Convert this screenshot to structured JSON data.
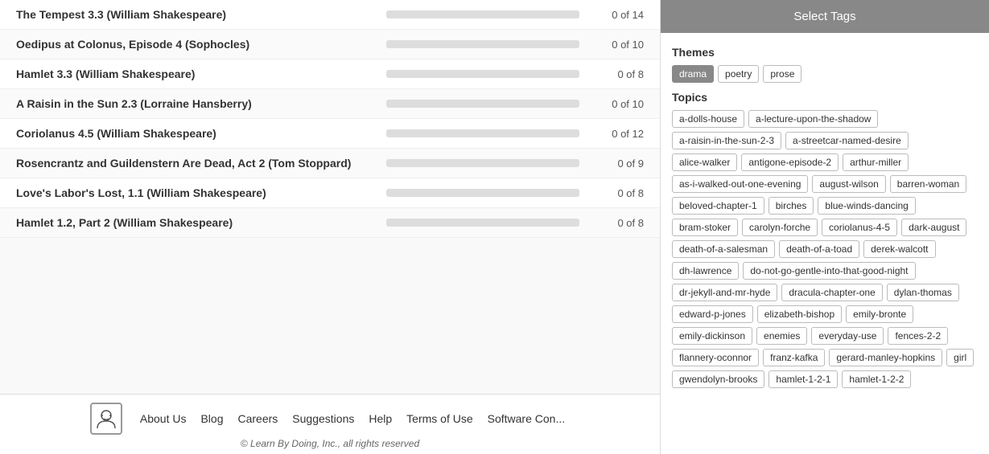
{
  "left": {
    "courses": [
      {
        "title": "The Tempest 3.3 (William Shakespeare)",
        "progress": 0,
        "total": 14
      },
      {
        "title": "Oedipus at Colonus, Episode 4 (Sophocles)",
        "progress": 0,
        "total": 10
      },
      {
        "title": "Hamlet 3.3 (William Shakespeare)",
        "progress": 0,
        "total": 8
      },
      {
        "title": "A Raisin in the Sun 2.3 (Lorraine Hansberry)",
        "progress": 0,
        "total": 10
      },
      {
        "title": "Coriolanus 4.5 (William Shakespeare)",
        "progress": 0,
        "total": 12
      },
      {
        "title": "Rosencrantz and Guildenstern Are Dead, Act 2 (Tom Stoppard)",
        "progress": 0,
        "total": 9
      },
      {
        "title": "Love's Labor's Lost, 1.1 (William Shakespeare)",
        "progress": 0,
        "total": 8
      },
      {
        "title": "Hamlet 1.2, Part 2 (William Shakespeare)",
        "progress": 0,
        "total": 8
      }
    ],
    "footer": {
      "links": [
        "About Us",
        "Blog",
        "Careers",
        "Suggestions",
        "Help",
        "Terms of Use",
        "Software Con..."
      ],
      "copyright": "© Learn By Doing, Inc., all rights reserved"
    }
  },
  "right": {
    "header": "Select Tags",
    "themes_label": "Themes",
    "themes": [
      {
        "label": "drama",
        "selected": true
      },
      {
        "label": "poetry",
        "selected": false
      },
      {
        "label": "prose",
        "selected": false
      }
    ],
    "topics_label": "Topics",
    "topics": [
      "a-dolls-house",
      "a-lecture-upon-the-shadow",
      "a-raisin-in-the-sun-2-3",
      "a-streetcar-named-desire",
      "alice-walker",
      "antigone-episode-2",
      "arthur-miller",
      "as-i-walked-out-one-evening",
      "august-wilson",
      "barren-woman",
      "beloved-chapter-1",
      "birches",
      "blue-winds-dancing",
      "bram-stoker",
      "carolyn-forche",
      "coriolanus-4-5",
      "dark-august",
      "death-of-a-salesman",
      "death-of-a-toad",
      "derek-walcott",
      "dh-lawrence",
      "do-not-go-gentle-into-that-good-night",
      "dr-jekyll-and-mr-hyde",
      "dracula-chapter-one",
      "dylan-thomas",
      "edward-p-jones",
      "elizabeth-bishop",
      "emily-bronte",
      "emily-dickinson",
      "enemies",
      "everyday-use",
      "fences-2-2",
      "flannery-oconnor",
      "franz-kafka",
      "gerard-manley-hopkins",
      "girl",
      "gwendolyn-brooks",
      "hamlet-1-2-1",
      "hamlet-1-2-2"
    ]
  }
}
